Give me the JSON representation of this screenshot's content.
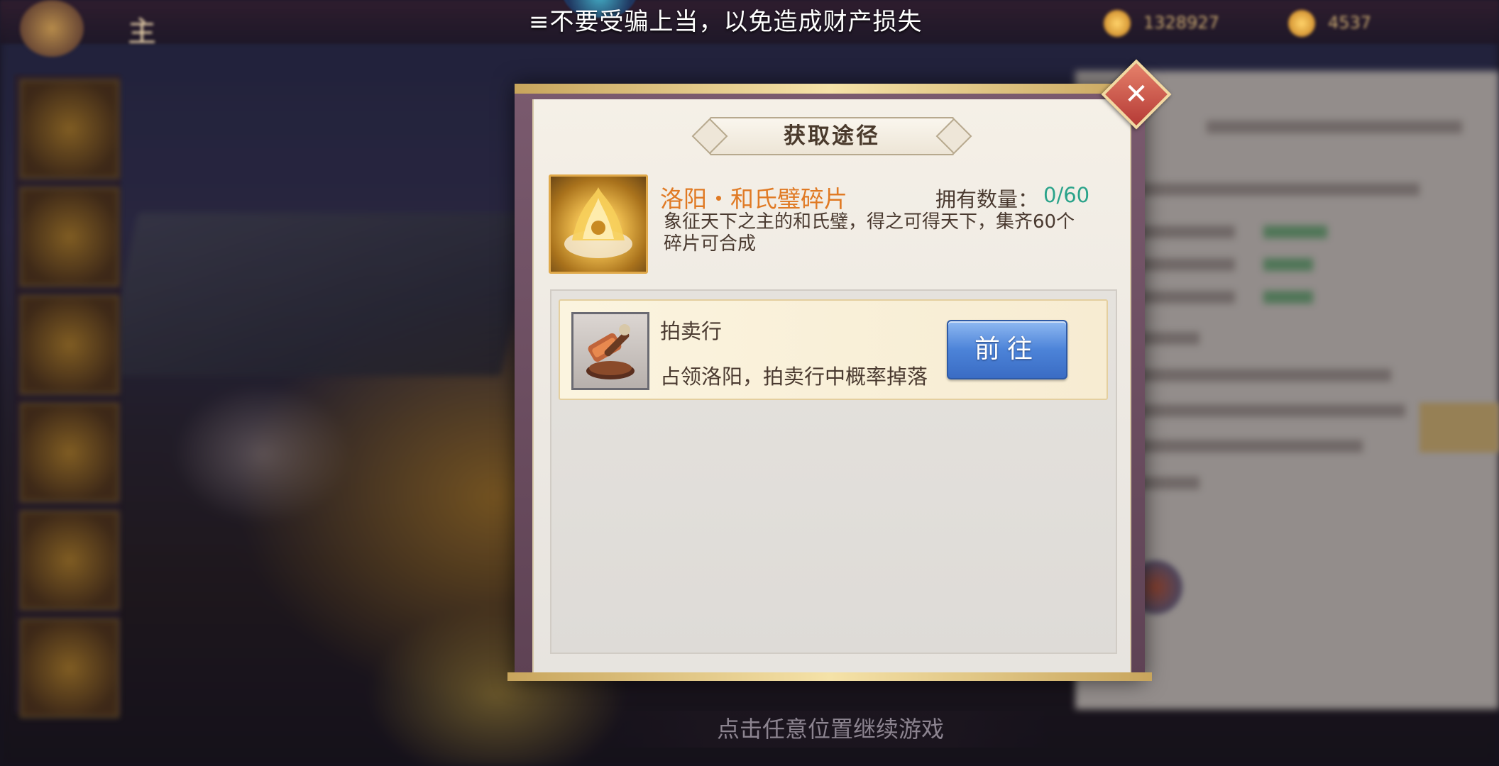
{
  "ticker": {
    "text": "≡不要受骗上当，以免造成财产损失"
  },
  "topbar": {
    "home_title": "主",
    "currency_1": "1328927",
    "currency_2": "4537"
  },
  "modal": {
    "title": "获取途径",
    "close_label": "✕",
    "item": {
      "name": "洛阳・和氏璧碎片",
      "own_label": "拥有数量：",
      "own_value": "0/60",
      "description": "象征天下之主的和氏璧，得之可得天下，集齐60个碎片可合成"
    },
    "sources": [
      {
        "title": "拍卖行",
        "description": "占领洛阳，拍卖行中概率掉落",
        "button_label": "前往"
      }
    ]
  },
  "hint": {
    "continue": "点击任意位置继续游戏"
  },
  "colors": {
    "item_name": "#e07a24",
    "own_value": "#2aa38a",
    "button_blue": "#4c83d8",
    "close_red": "#b53a36"
  },
  "icons": {
    "item": "jade-disc-fragment-icon",
    "source": "auction-gavel-icon",
    "close": "close-icon"
  }
}
